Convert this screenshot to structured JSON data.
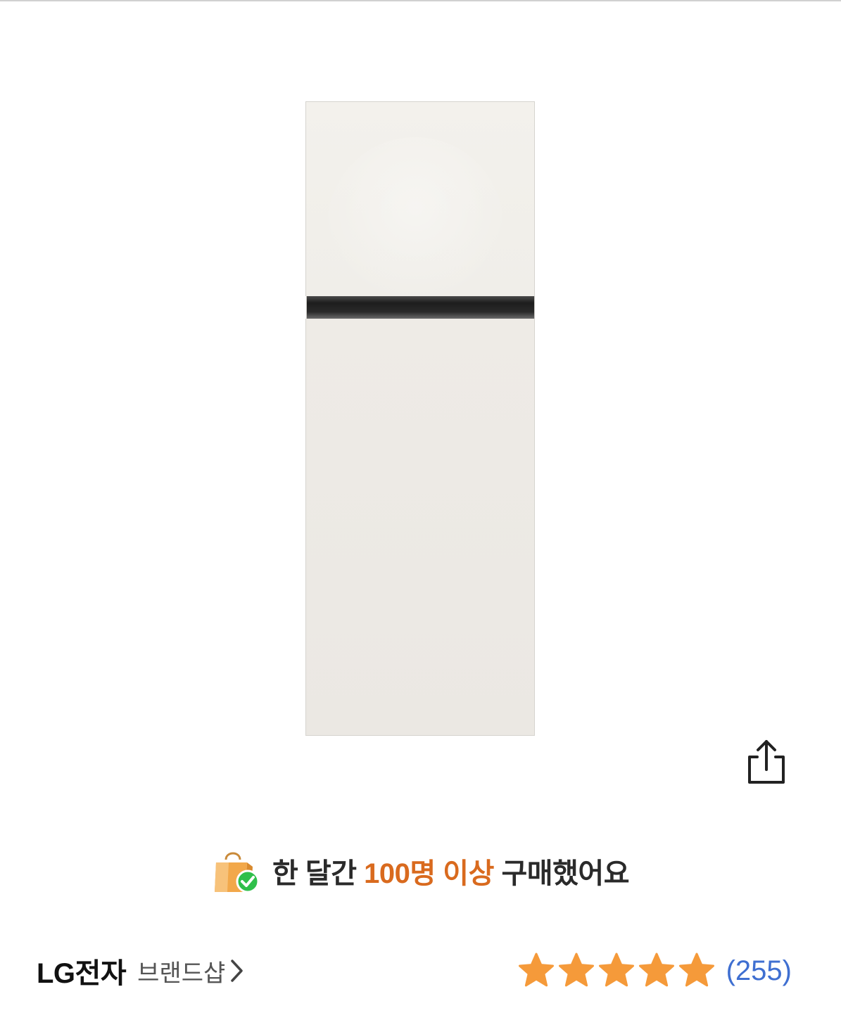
{
  "product": {
    "image_label": "LG refrigerator product image",
    "share_icon": "share-icon"
  },
  "purchase_banner": {
    "icon": "shopping-bag-check-icon",
    "text_prefix": "한 달간 ",
    "text_highlight": "100명 이상",
    "text_suffix": " 구매했어요",
    "highlight_color": "#d96a1e"
  },
  "brand": {
    "name": "LG전자",
    "shop_label": "브랜드샵",
    "chevron_icon": "chevron-right-icon"
  },
  "rating": {
    "stars": 5,
    "star_color": "#f59a3a",
    "review_count": "(255)",
    "review_count_color": "#3f6fd1"
  }
}
